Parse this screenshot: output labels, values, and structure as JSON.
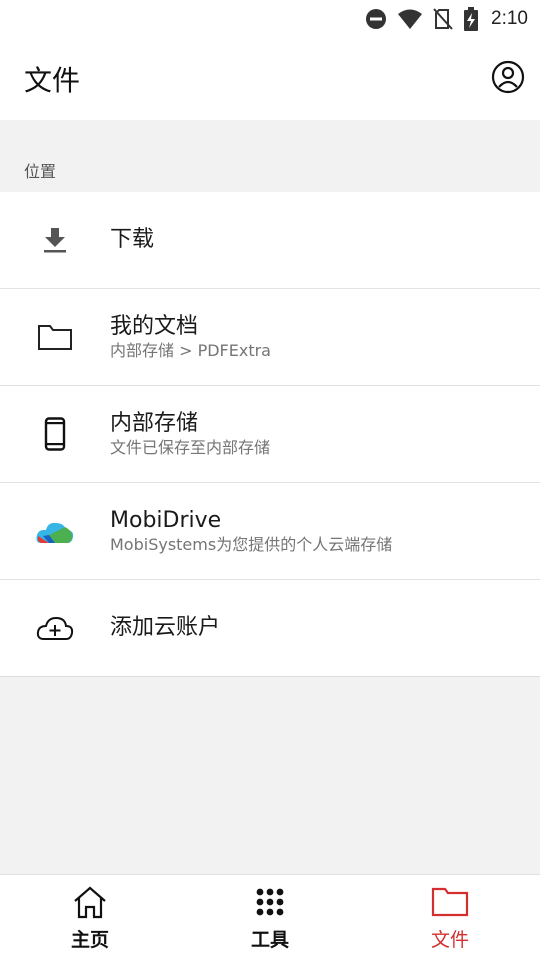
{
  "status_bar": {
    "time": "2:10",
    "icons": [
      "do-not-disturb-icon",
      "wifi-icon",
      "no-sim-icon",
      "battery-charging-icon"
    ]
  },
  "app_bar": {
    "title": "文件",
    "account_icon": "account-icon"
  },
  "section": {
    "label": "位置"
  },
  "locations": [
    {
      "icon": "download-icon",
      "title": "下载",
      "subtitle": ""
    },
    {
      "icon": "folder-icon",
      "title": "我的文档",
      "subtitle": "内部存储 > PDFExtra"
    },
    {
      "icon": "phone-icon",
      "title": "内部存储",
      "subtitle": "文件已保存至内部存储"
    },
    {
      "icon": "mobidrive-icon",
      "title": "MobiDrive",
      "subtitle": "MobiSystems为您提供的个人云端存储"
    },
    {
      "icon": "add-cloud-icon",
      "title": "添加云账户",
      "subtitle": ""
    }
  ],
  "bottom_nav": {
    "items": [
      {
        "icon": "home-icon",
        "label": "主页",
        "active": false
      },
      {
        "icon": "grid-icon",
        "label": "工具",
        "active": false
      },
      {
        "icon": "folder-icon",
        "label": "文件",
        "active": true
      }
    ],
    "active_color": "#d32f2f"
  }
}
